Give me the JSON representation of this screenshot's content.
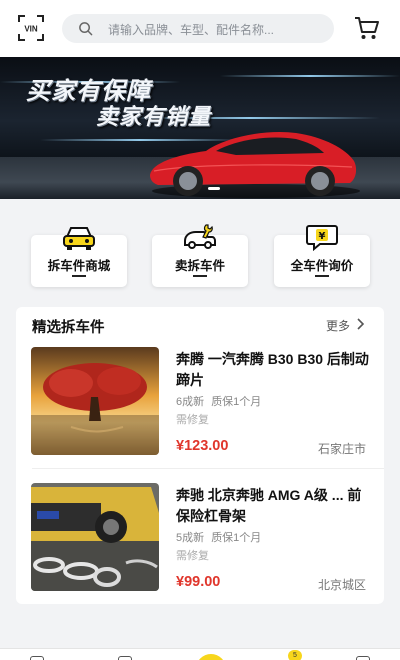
{
  "header": {
    "vin_label": "VIN",
    "search_placeholder": "请输入品牌、车型、配件名称...",
    "icons": [
      "vin-scan-icon",
      "search-icon",
      "cart-icon"
    ]
  },
  "banner": {
    "slogan_line1": "买家有保障",
    "slogan_line2": "卖家有销量"
  },
  "categories": [
    {
      "label": "拆车件商城",
      "icon": "car-front-icon"
    },
    {
      "label": "卖拆车件",
      "icon": "car-wrench-icon"
    },
    {
      "label": "全车件询价",
      "icon": "yen-chat-icon"
    }
  ],
  "section": {
    "title": "精选拆车件",
    "more": "更多"
  },
  "items": [
    {
      "title": "奔腾 一汽奔腾 B30 B30 后制动蹄片",
      "condition": "6成新",
      "warranty": "质保1个月",
      "note": "需修复",
      "price": "¥123.00",
      "location": "石家庄市"
    },
    {
      "title": "奔驰 北京奔驰 AMG A级 ... 前保险杠骨架",
      "condition": "5成新",
      "warranty": "质保1个月",
      "note": "需修复",
      "price": "¥99.00",
      "location": "北京城区"
    }
  ],
  "bottom_nav": {
    "badge": "5"
  },
  "colors": {
    "accent": "#f7d61c",
    "price": "#e0362c",
    "background": "#f2f3f5"
  }
}
